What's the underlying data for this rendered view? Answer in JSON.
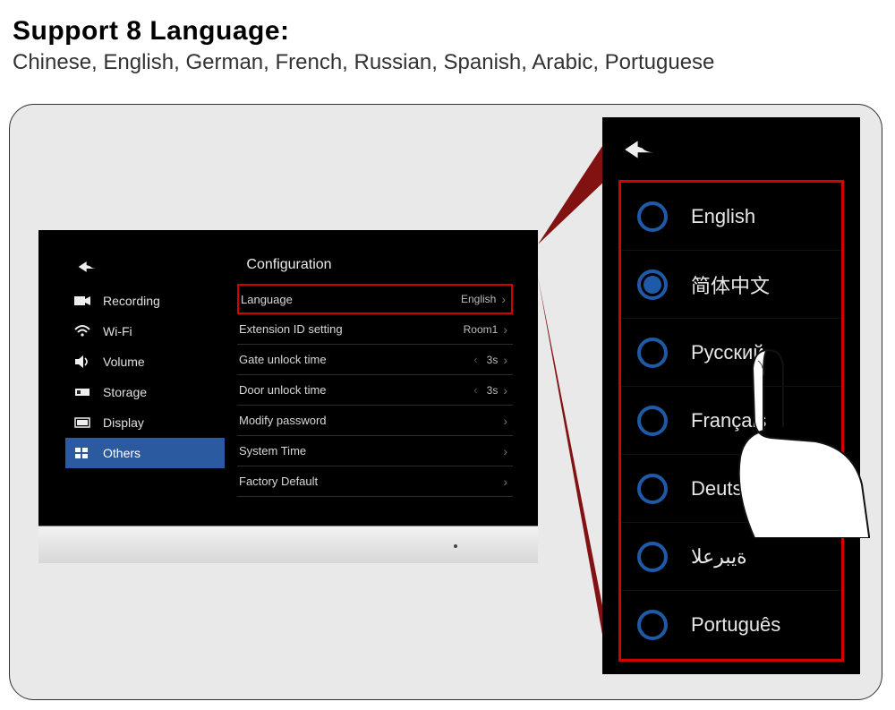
{
  "headline": "Support 8 Language:",
  "sublist": "Chinese, English, German, French, Russian, Spanish, Arabic, Portuguese",
  "screen": {
    "title": "Configuration",
    "sidebar": [
      {
        "icon": "camera",
        "label": "Recording"
      },
      {
        "icon": "wifi",
        "label": "Wi-Fi"
      },
      {
        "icon": "volume",
        "label": "Volume"
      },
      {
        "icon": "storage",
        "label": "Storage"
      },
      {
        "icon": "display",
        "label": "Display"
      },
      {
        "icon": "grid",
        "label": "Others",
        "active": true
      }
    ],
    "rows": [
      {
        "label": "Language",
        "value": "English",
        "nav": "chevron",
        "highlight": true
      },
      {
        "label": "Extension ID setting",
        "value": "Room1",
        "nav": "chevron"
      },
      {
        "label": "Gate unlock time",
        "value": "3s",
        "nav": "stepper"
      },
      {
        "label": "Door unlock time",
        "value": "3s",
        "nav": "stepper"
      },
      {
        "label": "Modify  password",
        "value": "",
        "nav": "chevron"
      },
      {
        "label": "System Time",
        "value": "",
        "nav": "chevron"
      },
      {
        "label": "Factory Default",
        "value": "",
        "nav": "chevron"
      }
    ]
  },
  "languages": [
    {
      "label": "English",
      "selected": false
    },
    {
      "label": "简体中文",
      "selected": true
    },
    {
      "label": "Русский",
      "selected": false
    },
    {
      "label": "Français",
      "selected": false
    },
    {
      "label": "Deutsch",
      "selected": false
    },
    {
      "label": "ةيبرعلا",
      "selected": false
    },
    {
      "label": "Português",
      "selected": false
    }
  ]
}
